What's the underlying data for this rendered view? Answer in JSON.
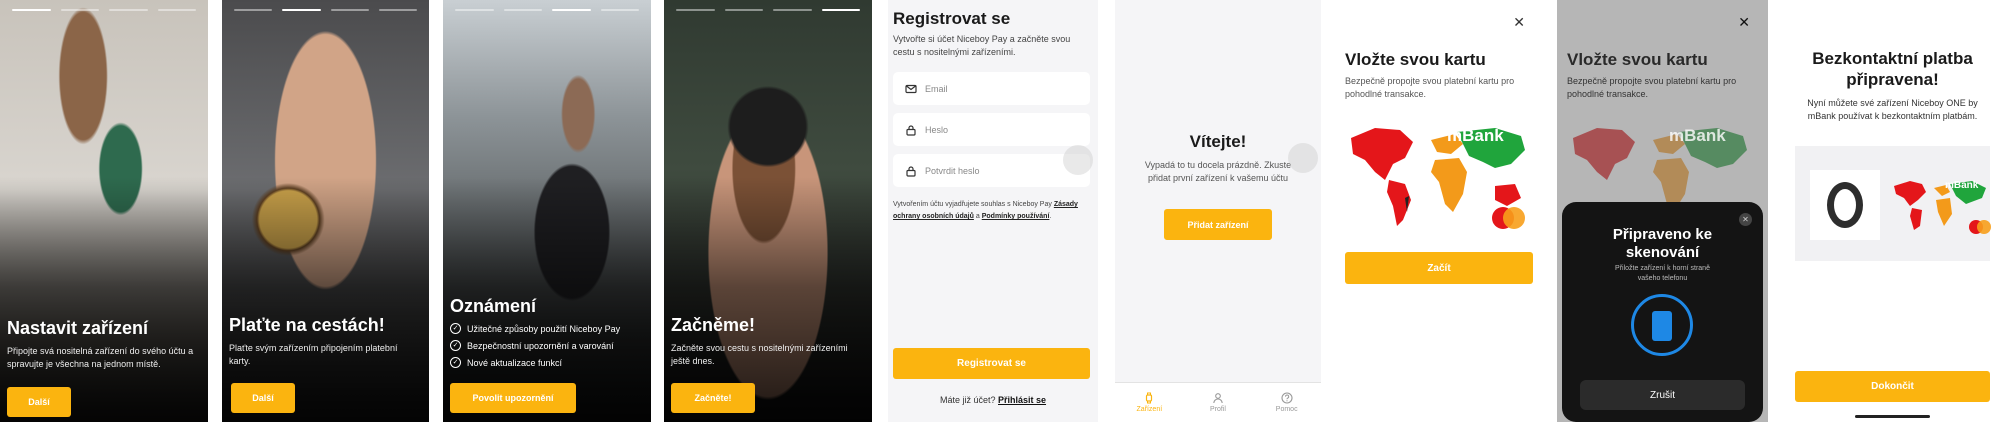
{
  "onboarding": [
    {
      "title": "Nastavit zařízení",
      "text": "Připojte svá nositelná zařízení do svého účtu a spravujte je všechna na jednom místě.",
      "button": "Další",
      "step": 1
    },
    {
      "title": "Plaťte na cestách!",
      "text": "Plaťte svým zařízením připojením platební karty.",
      "button": "Další",
      "step": 2
    },
    {
      "title": "Oznámení",
      "features": [
        "Užitečné způsoby použití Niceboy Pay",
        "Bezpečnostní upozornění a varování",
        "Nové aktualizace funkcí"
      ],
      "button": "Povolit upozornění",
      "step": 3
    },
    {
      "title": "Začněme!",
      "text": "Začněte svou cestu s nositelnými zařízeními ještě dnes.",
      "button": "Začněte!",
      "step": 4
    }
  ],
  "register": {
    "title": "Registrovat se",
    "subtitle": "Vytvořte si účet Niceboy Pay a začněte svou cestu s nositelnými zařízeními.",
    "email_placeholder": "Email",
    "password_placeholder": "Heslo",
    "confirm_placeholder": "Potvrdit heslo",
    "terms_prefix": "Vytvořením účtu vyjadřujete souhlas s Niceboy Pay",
    "privacy_link": "Zásady ochrany osobních údajů",
    "terms_and": "a",
    "terms_link": "Podmínky používání",
    "terms_suffix": ".",
    "button": "Registrovat se",
    "login_prompt": "Máte již účet?",
    "login_link": "Přihlásit se"
  },
  "welcome": {
    "title": "Vítejte!",
    "text": "Vypadá to tu docela prázdně. Zkuste přidat první zařízení k vašemu účtu",
    "button": "Přidat zařízení",
    "tabs": [
      "Zařízení",
      "Profil",
      "Pomoc"
    ]
  },
  "card": {
    "title": "Vložte svou kartu",
    "text": "Bezpečně propojte svou platební kartu pro pohodlné transakce.",
    "bank": "mBank",
    "button": "Začít",
    "close": "✕"
  },
  "scan": {
    "title": "Vložte svou kartu",
    "text": "Bezpečně propojte svou platební kartu pro pohodlné transakce.",
    "bank": "mBank",
    "sheet_title": "Připraveno ke skenování",
    "sheet_text": "Přiložte zařízení k horní straně vašeho telefonu",
    "cancel": "Zrušit",
    "close": "✕"
  },
  "ready": {
    "title": "Bezkontaktní platba připravena!",
    "text": "Nyní můžete své zařízení Niceboy ONE by mBank používat k bezkontaktním platbám.",
    "bank": "mBank",
    "button": "Dokončit"
  },
  "colors": {
    "accent": "#fbb40f"
  }
}
